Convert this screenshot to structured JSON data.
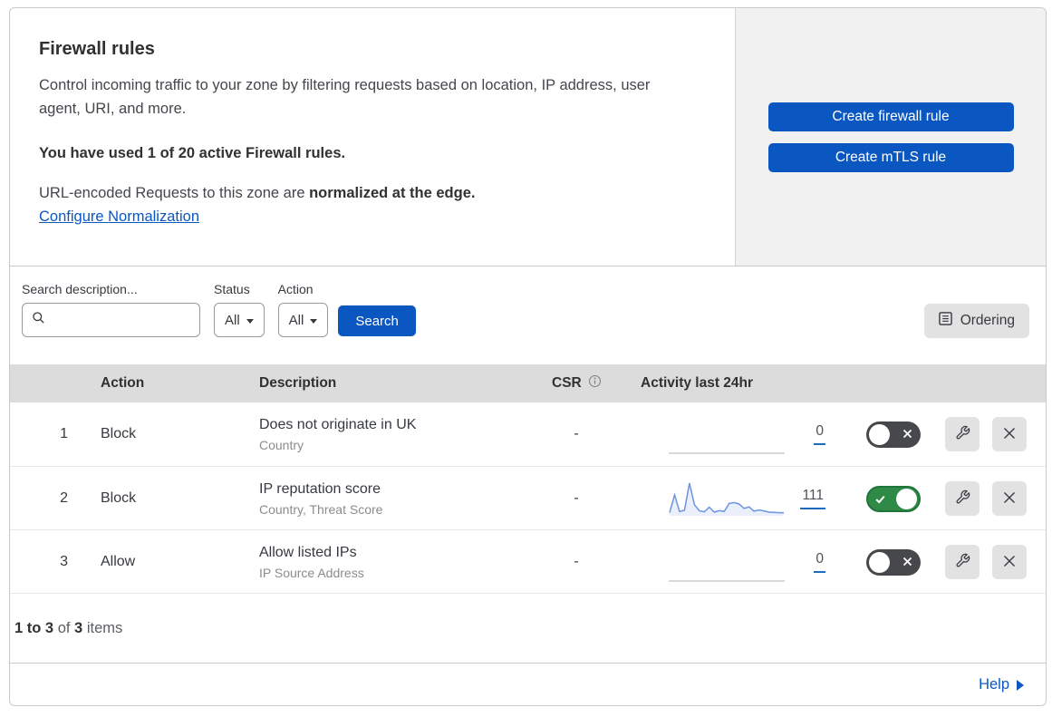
{
  "header": {
    "title": "Firewall rules",
    "description": "Control incoming traffic to your zone by filtering requests based on location, IP address, user agent, URI, and more.",
    "usage": "You have used 1 of 20 active Firewall rules.",
    "normalization_prefix": "URL-encoded Requests to this zone are ",
    "normalization_bold": "normalized at the edge.",
    "configure_link": "Configure Normalization",
    "create_firewall_button": "Create firewall rule",
    "create_mtls_button": "Create mTLS rule"
  },
  "filters": {
    "search_label": "Search description...",
    "search_value": "",
    "status_label": "Status",
    "status_value": "All",
    "action_label": "Action",
    "action_value": "All",
    "search_button": "Search",
    "ordering_button": "Ordering"
  },
  "table": {
    "columns": {
      "action": "Action",
      "description": "Description",
      "csr": "CSR",
      "activity": "Activity last 24hr"
    },
    "rows": [
      {
        "index": "1",
        "action": "Block",
        "title": "Does not originate in UK",
        "subtitle": "Country",
        "csr": "-",
        "count": "0",
        "enabled": false,
        "sparkline": []
      },
      {
        "index": "2",
        "action": "Block",
        "title": "IP reputation score",
        "subtitle": "Country, Threat Score",
        "csr": "-",
        "count": "111",
        "enabled": true,
        "sparkline": [
          4,
          62,
          8,
          12,
          100,
          30,
          10,
          7,
          22,
          6,
          11,
          8,
          34,
          37,
          32,
          18,
          23,
          9,
          13,
          10,
          6,
          5,
          4,
          4
        ]
      },
      {
        "index": "3",
        "action": "Allow",
        "title": "Allow listed IPs",
        "subtitle": "IP Source Address",
        "csr": "-",
        "count": "0",
        "enabled": false,
        "sparkline": []
      }
    ],
    "footer": {
      "range": "1 to 3",
      "of_text": " of ",
      "total": "3",
      "items_text": " items"
    }
  },
  "help": {
    "label": "Help"
  },
  "icons": {
    "search": "magnifier",
    "dropdown_chevron": "triangle-down",
    "info": "circled-i",
    "ordering": "list-page",
    "wrench": "wrench",
    "close": "x-cross",
    "toggle_check": "check-mark",
    "toggle_cross": "x-cross",
    "help_arrow": "triangle-right"
  },
  "colors": {
    "accent_blue": "#0b57c2",
    "toggle_on_green": "#2e8a46",
    "toggle_off_gray": "#47484b",
    "table_header_bg": "#dcdcdc",
    "panel_bg": "#f1f1f2",
    "sparkline_line": "#6d93e2",
    "sparkline_fill": "#e9effb",
    "flatline_gray": "#d9d9d9"
  }
}
